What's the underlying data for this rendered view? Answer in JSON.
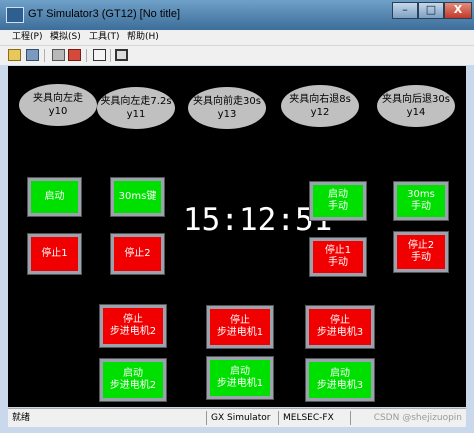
{
  "window": {
    "title": "GT Simulator3 (GT12)  [No title]",
    "minimize_label": "–",
    "maximize_label": "□",
    "close_label": "X"
  },
  "menu": [
    "工程(P)",
    "模拟(S)",
    "工具(T)",
    "帮助(H)"
  ],
  "lamps": [
    {
      "line1": "夹具向左走",
      "line2": "y10"
    },
    {
      "line1": "夹具向左走7.2s",
      "line2": "y11"
    },
    {
      "line1": "夹具向前走30s",
      "line2": "y13"
    },
    {
      "line1": "夹具向右退8s",
      "line2": "y12"
    },
    {
      "line1": "夹具向后退30s",
      "line2": "y14"
    }
  ],
  "clock": "15:12:51",
  "buttons": {
    "start1": {
      "line1": "启动",
      "line2": ""
    },
    "s30ms": {
      "line1": "30ms键",
      "line2": ""
    },
    "start_manual": {
      "line1": "启动",
      "line2": "手动"
    },
    "s30ms_manual": {
      "line1": "30ms",
      "line2": "手动"
    },
    "stop1": {
      "line1": "停止1",
      "line2": ""
    },
    "stop2": {
      "line1": "停止2",
      "line2": ""
    },
    "stop1_manual": {
      "line1": "停止1",
      "line2": "手动"
    },
    "stop2_manual": {
      "line1": "停止2",
      "line2": "手动"
    },
    "stop_motor2": {
      "line1": "停止",
      "line2": "步进电机2"
    },
    "stop_motor1": {
      "line1": "停止",
      "line2": "步进电机1"
    },
    "stop_motor3": {
      "line1": "停止",
      "line2": "步进电机3"
    },
    "start_motor2": {
      "line1": "启动",
      "line2": "步进电机2"
    },
    "start_motor1": {
      "line1": "启动",
      "line2": "步进电机1"
    },
    "start_motor3": {
      "line1": "启动",
      "line2": "步进电机3"
    }
  },
  "status": {
    "ready": "就绪",
    "simulator": "GX Simulator",
    "plc": "MELSEC-FX",
    "watermark": "CSDN @shejizuopin"
  },
  "colors": {
    "green": "#00e000",
    "red": "#f00000",
    "screen": "#000000"
  }
}
